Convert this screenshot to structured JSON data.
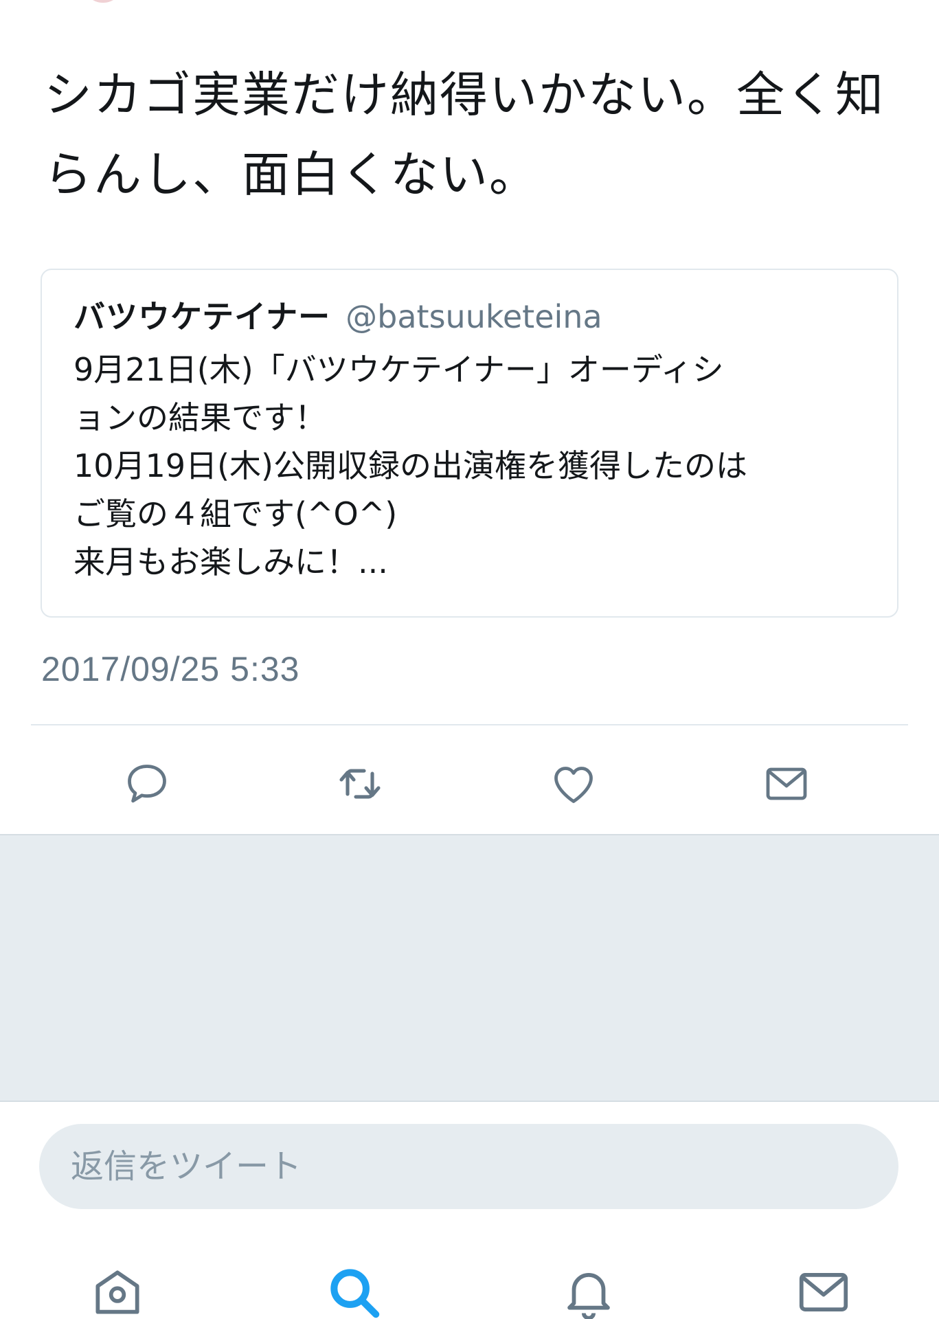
{
  "tweet": {
    "text": "シカゴ実業だけ納得いかない。全く知らんし、面白くない。",
    "timestamp": "2017/09/25 5:33"
  },
  "quote": {
    "name": "バツウケテイナー",
    "handle": "@batsuuketeina",
    "lines": [
      "9月21日(木)「バツウケテイナー」オーディシ",
      "ョンの結果です！",
      "10月19日(木)公開収録の出演権を獲得したのは",
      "ご覧の４組です(^O^)",
      "来月もお楽しみに！..."
    ]
  },
  "actions": {
    "reply_icon": "reply-icon",
    "retweet_icon": "retweet-icon",
    "like_icon": "heart-icon",
    "dm_icon": "envelope-icon"
  },
  "reply": {
    "placeholder": "返信をツイート"
  },
  "tabs": {
    "home_icon": "home-icon",
    "search_icon": "search-icon",
    "notifications_icon": "bell-icon",
    "messages_icon": "envelope-icon"
  },
  "colors": {
    "text": "#14171a",
    "secondary": "#657786",
    "icon": "#657786",
    "accent": "#1da1f2",
    "border": "#e1e8ed",
    "band": "#e6ecf0"
  }
}
